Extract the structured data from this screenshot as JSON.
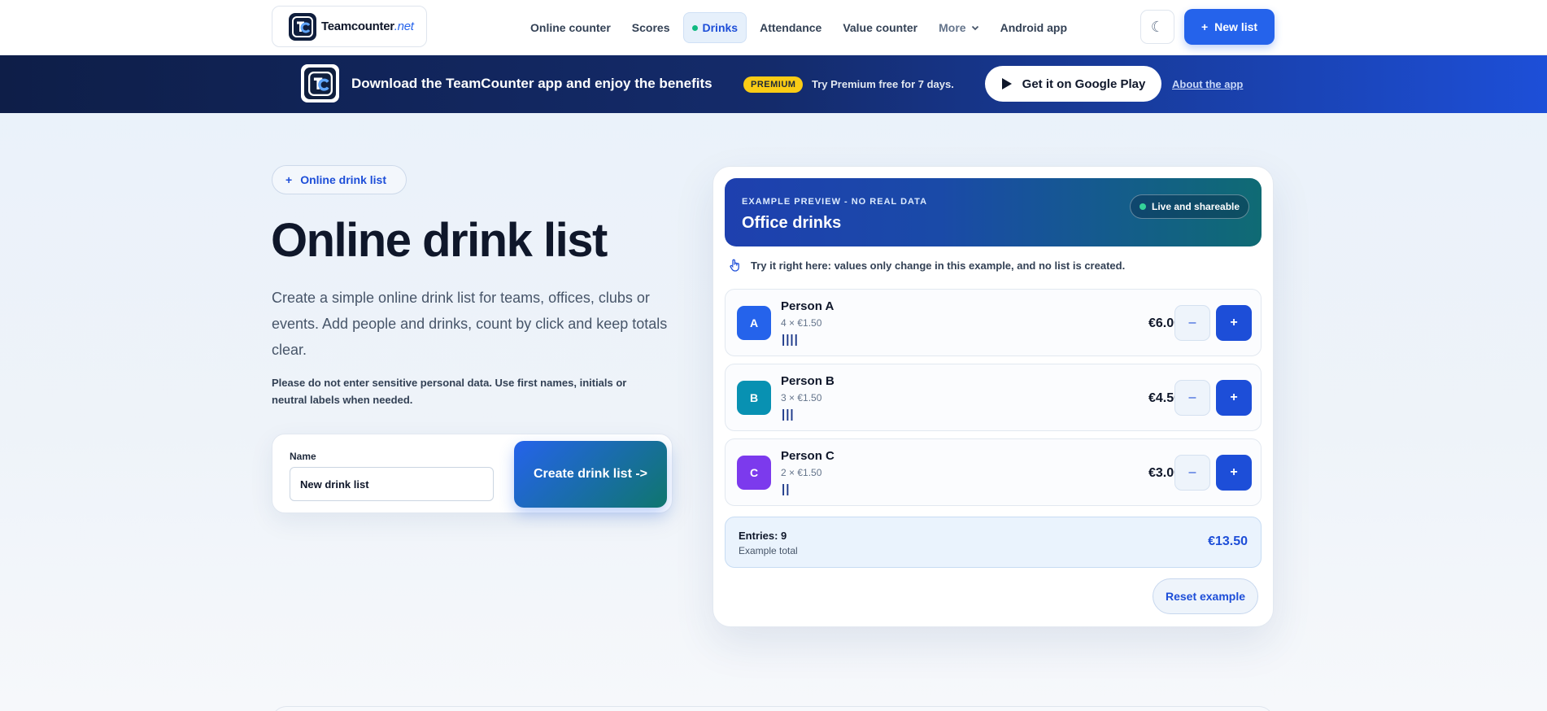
{
  "nav": {
    "logo_name": "Teamcounter",
    "logo_tld": ".net",
    "links": [
      {
        "label": "Online counter"
      },
      {
        "label": "Scores"
      },
      {
        "label": "Drinks"
      },
      {
        "label": "Attendance"
      },
      {
        "label": "Value counter"
      },
      {
        "label": "More"
      },
      {
        "label": "Android app"
      }
    ],
    "theme_icon": "☾",
    "new_list_icon": "+",
    "new_list_label": "New list"
  },
  "banner": {
    "title": "Download the TeamCounter app and enjoy the benefits",
    "badge": "PREMIUM",
    "subtitle": "Try Premium free for 7 days.",
    "gplay_label": "Get it on Google Play",
    "about_link": "About the app"
  },
  "hero": {
    "pill_icon": "+",
    "pill_label": "Online drink list",
    "title": "Online drink list",
    "description": "Create a simple online drink list for teams, offices, clubs or events. Add people and drinks, count by click and keep totals clear.",
    "note": "Please do not enter sensitive personal data. Use first names, initials or neutral labels when needed.",
    "form": {
      "name_label": "Name",
      "name_value": "New drink list",
      "create_label": "Create drink list ->"
    }
  },
  "preview": {
    "kicker": "EXAMPLE PREVIEW - NO REAL DATA",
    "title": "Office drinks",
    "live_badge": "Live and shareable",
    "try_text": "Try it right here: values only change in this example, and no list is created.",
    "people": [
      {
        "initial": "A",
        "name": "Person A",
        "count": "4 × €1.50",
        "tally": "||||",
        "total": "€6.00",
        "color": "#2563eb"
      },
      {
        "initial": "B",
        "name": "Person B",
        "count": "3 × €1.50",
        "tally": "|||",
        "total": "€4.50",
        "color": "#0891b2"
      },
      {
        "initial": "C",
        "name": "Person C",
        "count": "2 × €1.50",
        "tally": "||",
        "total": "€3.00",
        "color": "#7c3aed"
      }
    ],
    "minus_label": "–",
    "plus_label": "+",
    "summary": {
      "entries": "Entries: 9",
      "sub": "Example total",
      "total": "€13.50"
    },
    "reset_label": "Reset example"
  },
  "colors": {
    "accent": "#2563eb",
    "banner_dark": "#0e1e48",
    "premium": "#facc15",
    "live_dot": "#34d399"
  }
}
